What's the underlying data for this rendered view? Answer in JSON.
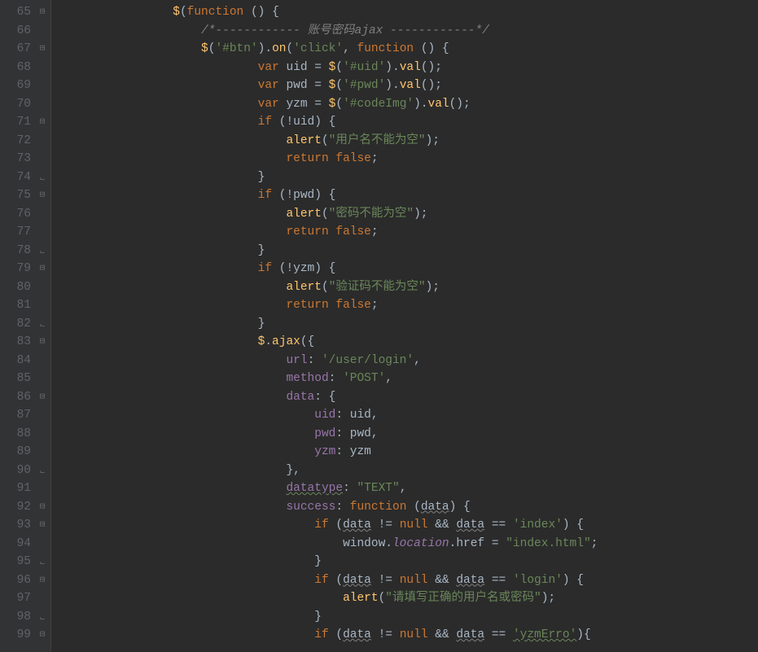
{
  "editor": {
    "first_line_number": 65,
    "lines": [
      {
        "n": "65",
        "folds": [
          "open"
        ],
        "segs": [
          [
            "pad",
            "                "
          ],
          [
            "glob",
            "$"
          ],
          [
            "punc",
            "("
          ],
          [
            "kw",
            "function"
          ],
          [
            "punc",
            " () {"
          ]
        ]
      },
      {
        "n": "66",
        "folds": [],
        "segs": [
          [
            "pad",
            "                    "
          ],
          [
            "cmt",
            "/*------------ 账号密码ajax ------------*/"
          ]
        ]
      },
      {
        "n": "67",
        "folds": [
          "open"
        ],
        "segs": [
          [
            "pad",
            "                    "
          ],
          [
            "glob",
            "$"
          ],
          [
            "punc",
            "("
          ],
          [
            "str",
            "'#btn'"
          ],
          [
            "punc",
            ")."
          ],
          [
            "mtd",
            "on"
          ],
          [
            "punc",
            "("
          ],
          [
            "str",
            "'click'"
          ],
          [
            "punc",
            ", "
          ],
          [
            "kw",
            "function"
          ],
          [
            "punc",
            " () {"
          ]
        ]
      },
      {
        "n": "68",
        "folds": [],
        "segs": [
          [
            "pad",
            "                            "
          ],
          [
            "kw",
            "var "
          ],
          [
            "id",
            "uid"
          ],
          [
            "punc",
            " = "
          ],
          [
            "glob",
            "$"
          ],
          [
            "punc",
            "("
          ],
          [
            "str",
            "'#uid'"
          ],
          [
            "punc",
            ")."
          ],
          [
            "mtd",
            "val"
          ],
          [
            "punc",
            "();"
          ]
        ]
      },
      {
        "n": "69",
        "folds": [],
        "segs": [
          [
            "pad",
            "                            "
          ],
          [
            "kw",
            "var "
          ],
          [
            "id",
            "pwd"
          ],
          [
            "punc",
            " = "
          ],
          [
            "glob",
            "$"
          ],
          [
            "punc",
            "("
          ],
          [
            "str",
            "'#pwd'"
          ],
          [
            "punc",
            ")."
          ],
          [
            "mtd",
            "val"
          ],
          [
            "punc",
            "();"
          ]
        ]
      },
      {
        "n": "70",
        "folds": [],
        "segs": [
          [
            "pad",
            "                            "
          ],
          [
            "kw",
            "var "
          ],
          [
            "id",
            "yzm"
          ],
          [
            "punc",
            " = "
          ],
          [
            "glob",
            "$"
          ],
          [
            "punc",
            "("
          ],
          [
            "str",
            "'#codeImg'"
          ],
          [
            "punc",
            ")."
          ],
          [
            "mtd",
            "val"
          ],
          [
            "punc",
            "();"
          ]
        ]
      },
      {
        "n": "71",
        "folds": [
          "open"
        ],
        "segs": [
          [
            "pad",
            "                            "
          ],
          [
            "kw",
            "if"
          ],
          [
            "punc",
            " (!"
          ],
          [
            "id",
            "uid"
          ],
          [
            "punc",
            ") {"
          ]
        ]
      },
      {
        "n": "72",
        "folds": [],
        "segs": [
          [
            "pad",
            "                                "
          ],
          [
            "mtd",
            "alert"
          ],
          [
            "punc",
            "("
          ],
          [
            "str",
            "\"用户名不能为空\""
          ],
          [
            "punc",
            ");"
          ]
        ]
      },
      {
        "n": "73",
        "folds": [],
        "segs": [
          [
            "pad",
            "                                "
          ],
          [
            "kw",
            "return false"
          ],
          [
            "punc",
            ";"
          ]
        ]
      },
      {
        "n": "74",
        "folds": [
          "close"
        ],
        "segs": [
          [
            "pad",
            "                            "
          ],
          [
            "punc",
            "}"
          ]
        ]
      },
      {
        "n": "75",
        "folds": [
          "open"
        ],
        "segs": [
          [
            "pad",
            "                            "
          ],
          [
            "kw",
            "if"
          ],
          [
            "punc",
            " (!"
          ],
          [
            "id",
            "pwd"
          ],
          [
            "punc",
            ") {"
          ]
        ]
      },
      {
        "n": "76",
        "folds": [],
        "segs": [
          [
            "pad",
            "                                "
          ],
          [
            "mtd",
            "alert"
          ],
          [
            "punc",
            "("
          ],
          [
            "str",
            "\"密码不能为空\""
          ],
          [
            "punc",
            ");"
          ]
        ]
      },
      {
        "n": "77",
        "folds": [],
        "segs": [
          [
            "pad",
            "                                "
          ],
          [
            "kw",
            "return false"
          ],
          [
            "punc",
            ";"
          ]
        ]
      },
      {
        "n": "78",
        "folds": [
          "close"
        ],
        "segs": [
          [
            "pad",
            "                            "
          ],
          [
            "punc",
            "}"
          ]
        ]
      },
      {
        "n": "79",
        "folds": [
          "open"
        ],
        "segs": [
          [
            "pad",
            "                            "
          ],
          [
            "kw",
            "if"
          ],
          [
            "punc",
            " (!"
          ],
          [
            "id",
            "yzm"
          ],
          [
            "punc",
            ") {"
          ]
        ]
      },
      {
        "n": "80",
        "folds": [],
        "segs": [
          [
            "pad",
            "                                "
          ],
          [
            "mtd",
            "alert"
          ],
          [
            "punc",
            "("
          ],
          [
            "str",
            "\"验证码不能为空\""
          ],
          [
            "punc",
            ");"
          ]
        ]
      },
      {
        "n": "81",
        "folds": [],
        "segs": [
          [
            "pad",
            "                                "
          ],
          [
            "kw",
            "return false"
          ],
          [
            "punc",
            ";"
          ]
        ]
      },
      {
        "n": "82",
        "folds": [
          "close"
        ],
        "segs": [
          [
            "pad",
            "                            "
          ],
          [
            "punc",
            "}"
          ]
        ]
      },
      {
        "n": "83",
        "folds": [
          "open"
        ],
        "segs": [
          [
            "pad",
            "                            "
          ],
          [
            "glob",
            "$"
          ],
          [
            "punc",
            "."
          ],
          [
            "mtd",
            "ajax"
          ],
          [
            "punc",
            "({"
          ]
        ]
      },
      {
        "n": "84",
        "folds": [],
        "segs": [
          [
            "pad",
            "                                "
          ],
          [
            "prop",
            "url"
          ],
          [
            "punc",
            ": "
          ],
          [
            "str",
            "'/user/login'"
          ],
          [
            "punc",
            ","
          ]
        ]
      },
      {
        "n": "85",
        "folds": [],
        "segs": [
          [
            "pad",
            "                                "
          ],
          [
            "prop",
            "method"
          ],
          [
            "punc",
            ": "
          ],
          [
            "str",
            "'POST'"
          ],
          [
            "punc",
            ","
          ]
        ]
      },
      {
        "n": "86",
        "folds": [
          "open"
        ],
        "segs": [
          [
            "pad",
            "                                "
          ],
          [
            "prop",
            "data"
          ],
          [
            "punc",
            ": {"
          ]
        ]
      },
      {
        "n": "87",
        "folds": [],
        "segs": [
          [
            "pad",
            "                                    "
          ],
          [
            "prop",
            "uid"
          ],
          [
            "punc",
            ": "
          ],
          [
            "id",
            "uid"
          ],
          [
            "punc",
            ","
          ]
        ]
      },
      {
        "n": "88",
        "folds": [],
        "segs": [
          [
            "pad",
            "                                    "
          ],
          [
            "prop",
            "pwd"
          ],
          [
            "punc",
            ": "
          ],
          [
            "id",
            "pwd"
          ],
          [
            "punc",
            ","
          ]
        ]
      },
      {
        "n": "89",
        "folds": [],
        "segs": [
          [
            "pad",
            "                                    "
          ],
          [
            "prop",
            "yzm"
          ],
          [
            "punc",
            ": "
          ],
          [
            "id",
            "yzm"
          ]
        ]
      },
      {
        "n": "90",
        "folds": [
          "close"
        ],
        "segs": [
          [
            "pad",
            "                                "
          ],
          [
            "punc",
            "},"
          ]
        ]
      },
      {
        "n": "91",
        "folds": [],
        "segs": [
          [
            "pad",
            "                                "
          ],
          [
            "propul",
            "datatype"
          ],
          [
            "punc",
            ": "
          ],
          [
            "str",
            "\"TEXT\""
          ],
          [
            "punc",
            ","
          ]
        ]
      },
      {
        "n": "92",
        "folds": [
          "open"
        ],
        "segs": [
          [
            "pad",
            "                                "
          ],
          [
            "prop",
            "success"
          ],
          [
            "punc",
            ": "
          ],
          [
            "kw",
            "function"
          ],
          [
            "punc",
            " ("
          ],
          [
            "idul",
            "data"
          ],
          [
            "punc",
            ") {"
          ]
        ]
      },
      {
        "n": "93",
        "folds": [
          "open"
        ],
        "segs": [
          [
            "pad",
            "                                    "
          ],
          [
            "kw",
            "if"
          ],
          [
            "punc",
            " ("
          ],
          [
            "idul",
            "data"
          ],
          [
            "punc",
            " != "
          ],
          [
            "kw",
            "null"
          ],
          [
            "punc",
            " && "
          ],
          [
            "idul",
            "data"
          ],
          [
            "punc",
            " == "
          ],
          [
            "str",
            "'index'"
          ],
          [
            "punc",
            ") {"
          ]
        ]
      },
      {
        "n": "94",
        "folds": [],
        "segs": [
          [
            "pad",
            "                                        "
          ],
          [
            "id",
            "window"
          ],
          [
            "punc",
            "."
          ],
          [
            "static",
            "location"
          ],
          [
            "punc",
            "."
          ],
          [
            "id",
            "href"
          ],
          [
            "punc",
            " = "
          ],
          [
            "str",
            "\"index.html\""
          ],
          [
            "punc",
            ";"
          ]
        ]
      },
      {
        "n": "95",
        "folds": [
          "close"
        ],
        "segs": [
          [
            "pad",
            "                                    "
          ],
          [
            "punc",
            "}"
          ]
        ]
      },
      {
        "n": "96",
        "folds": [
          "open"
        ],
        "segs": [
          [
            "pad",
            "                                    "
          ],
          [
            "kw",
            "if"
          ],
          [
            "punc",
            " ("
          ],
          [
            "idul",
            "data"
          ],
          [
            "punc",
            " != "
          ],
          [
            "kw",
            "null"
          ],
          [
            "punc",
            " && "
          ],
          [
            "idul",
            "data"
          ],
          [
            "punc",
            " == "
          ],
          [
            "str",
            "'login'"
          ],
          [
            "punc",
            ") {"
          ]
        ]
      },
      {
        "n": "97",
        "folds": [],
        "segs": [
          [
            "pad",
            "                                        "
          ],
          [
            "mtd",
            "alert"
          ],
          [
            "punc",
            "("
          ],
          [
            "str",
            "\"请填写正确的用户名或密码\""
          ],
          [
            "punc",
            ");"
          ]
        ]
      },
      {
        "n": "98",
        "folds": [
          "close"
        ],
        "segs": [
          [
            "pad",
            "                                    "
          ],
          [
            "punc",
            "}"
          ]
        ]
      },
      {
        "n": "99",
        "folds": [
          "open"
        ],
        "segs": [
          [
            "pad",
            "                                    "
          ],
          [
            "kw",
            "if"
          ],
          [
            "punc",
            " ("
          ],
          [
            "idul",
            "data"
          ],
          [
            "punc",
            " != "
          ],
          [
            "kw",
            "null"
          ],
          [
            "punc",
            " && "
          ],
          [
            "idul",
            "data"
          ],
          [
            "punc",
            " == "
          ],
          [
            "strul",
            "'yzmErro'"
          ],
          [
            "punc",
            "){"
          ]
        ]
      }
    ]
  }
}
